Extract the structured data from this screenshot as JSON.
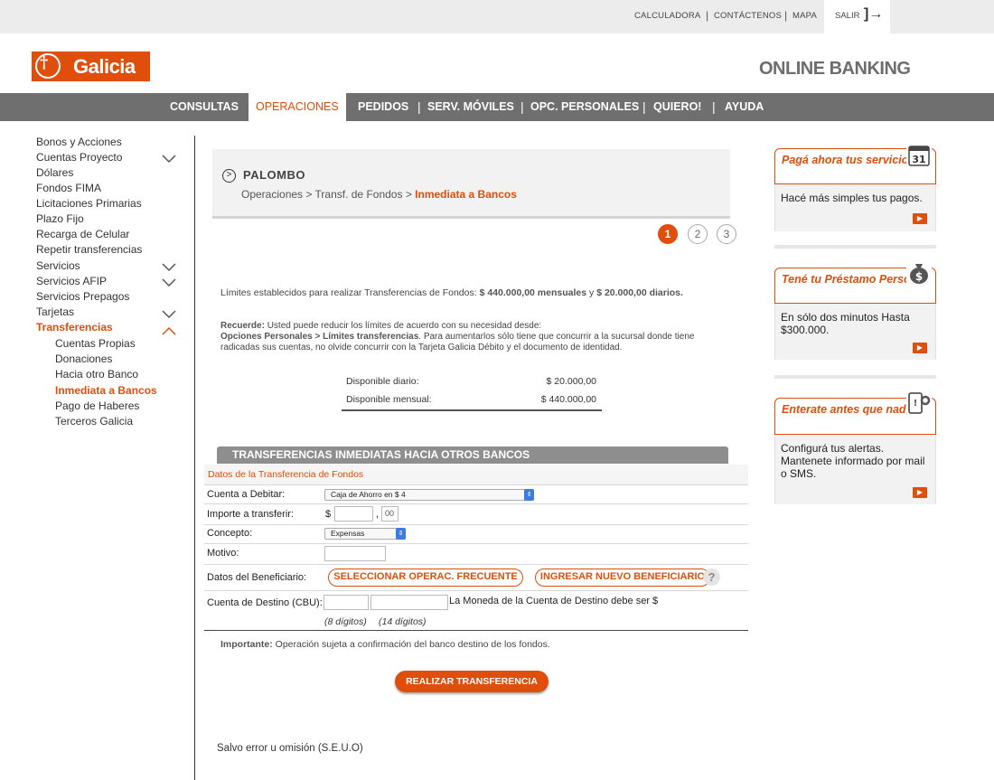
{
  "topbar": {
    "links": [
      "CALCULADORA",
      "CONTÁCTENOS",
      "MAPA"
    ],
    "logout": "SALIR"
  },
  "header": {
    "logo_text": "Galicia",
    "brand_text": "ONLINE BANKING"
  },
  "nav": {
    "items": [
      "CONSULTAS",
      "OPERACIONES",
      "PEDIDOS",
      "SERV. MÓVILES",
      "OPC. PERSONALES",
      "QUIERO!",
      "AYUDA"
    ],
    "active": "OPERACIONES"
  },
  "sidebar": {
    "items": [
      "Bonos y Acciones",
      "Cuentas Proyecto",
      "Dólares",
      "Fondos FIMA",
      "Licitaciones Primarias",
      "Plazo Fijo",
      "Recarga de Celular",
      "Repetir transferencias",
      "Servicios",
      "Servicios AFIP",
      "Servicios Prepagos",
      "Tarjetas",
      "Transferencias"
    ],
    "subitems": [
      "Cuentas Propias",
      "Donaciones",
      "Hacia otro Banco",
      "Inmediata a Bancos",
      "Pago de Haberes",
      "Terceros Galicia"
    ],
    "active_item": "Transferencias",
    "active_subitem": "Inmediata a Bancos"
  },
  "breadcrumb": {
    "user": "PALOMBO",
    "path_1": "Operaciones",
    "path_2": "Transf. de Fondos",
    "current": "Inmediata a Bancos",
    "sep": ">"
  },
  "steps": [
    "1",
    "2",
    "3"
  ],
  "limits": {
    "prefix": "Límites establecidos para realizar Transferencias de Fondos:",
    "monthly": "$ 440.000,00 mensuales",
    "and": "y",
    "daily": "$ 20.000,00 diarios."
  },
  "remember": {
    "label": "Recuerde:",
    "text1": "Usted puede reducir los límites de acuerdo con su necesidad desde:",
    "path": "Opciones Personales > Límites transferencias",
    "text2": ". Para aumentarlos sólo tiene que concurrir a la sucursal donde tiene radicadas sus cuentas, no olvide concurrir con la Tarjeta Galicia Débito y el documento de identidad."
  },
  "available": {
    "daily_label": "Disponible diario:",
    "daily_value": "$ 20.000,00",
    "monthly_label": "Disponible mensual:",
    "monthly_value": "$ 440.000,00"
  },
  "form": {
    "header": "TRANSFERENCIAS INMEDIATAS HACIA OTROS BANCOS",
    "subheader": "Datos de la Transferencia de Fondos",
    "account_label": "Cuenta a Debitar:",
    "account_value": "Caja de Ahorro en $ 4",
    "amount_label": "Importe a transferir:",
    "currency": "$",
    "amount_int": "",
    "decimal_sep": ",",
    "amount_dec": "00",
    "concept_label": "Concepto:",
    "concept_value": "Expensas",
    "reason_label": "Motivo:",
    "reason_value": "",
    "beneficiary_label": "Datos del Beneficiario:",
    "btn_frequent": "SELECCIONAR OPERAC. FRECUENTE",
    "btn_new": "INGRESAR NUEVO BENEFICIARIO",
    "help": "?",
    "cbu_label": "Cuenta de Destino (CBU):",
    "cbu_note": "La Moneda de la Cuenta de Destino debe ser $",
    "hint_8": "(8 dígitos)",
    "hint_14": "(14 dígitos)",
    "important_label": "Importante:",
    "important_text": "Operación sujeta a confirmación del banco destino de los fondos.",
    "submit": "REALIZAR TRANSFERENCIA"
  },
  "footer_note": "Salvo error u omisión (S.E.U.O)",
  "promos": [
    {
      "title": "Pagá ahora tus servicios",
      "body": "Hacé más simples tus pagos.",
      "icon": "calendar-icon",
      "icon_text": "31"
    },
    {
      "title": "Tené tu Préstamo Personal",
      "body": "En sólo dos minutos Hasta $300.000.",
      "icon": "money-bag-icon",
      "icon_text": "$"
    },
    {
      "title": "Enterate antes que nadie",
      "body": "Configurá tus alertas. Mantenete informado por mail o SMS.",
      "icon": "mobile-alert-icon",
      "icon_text": ""
    }
  ],
  "colors": {
    "accent": "#e04e0b",
    "nav_bg": "#6f6f6f",
    "panel_bg": "#f2f2f2"
  }
}
